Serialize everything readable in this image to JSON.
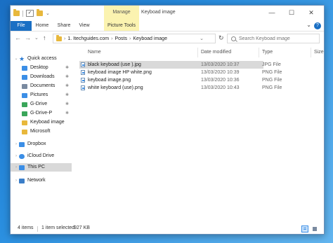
{
  "window": {
    "title": "Keyboad image",
    "manage_label": "Manage",
    "minimize": "—",
    "maximize": "☐",
    "close": "✕"
  },
  "ribbon": {
    "tabs": [
      {
        "label": "File"
      },
      {
        "label": "Home"
      },
      {
        "label": "Share"
      },
      {
        "label": "View"
      },
      {
        "label": "Picture Tools"
      }
    ],
    "collapse": "⌄",
    "help": "?"
  },
  "nav": {
    "back": "←",
    "forward": "→",
    "recent": "⌄",
    "up": "↑",
    "breadcrumb": [
      "1. Itechguides.com",
      "Posts",
      "Keyboad image"
    ],
    "breadcrumb_sep": "›",
    "dropdown": "⌄",
    "refresh": "↻"
  },
  "search": {
    "placeholder": "Search Keyboad image"
  },
  "sidebar": {
    "items": [
      {
        "label": "Quick access",
        "icon": "star-icon"
      },
      {
        "label": "Desktop",
        "icon": "desktop-icon",
        "pinned": true
      },
      {
        "label": "Downloads",
        "icon": "download-icon",
        "pinned": true
      },
      {
        "label": "Documents",
        "icon": "documents-icon",
        "pinned": true
      },
      {
        "label": "Pictures",
        "icon": "pictures-icon",
        "pinned": true
      },
      {
        "label": "G-Drive",
        "icon": "drive-icon",
        "pinned": true
      },
      {
        "label": "G-Drive-P",
        "icon": "drive-icon",
        "pinned": true
      },
      {
        "label": "Keyboad image",
        "icon": "folder-icon"
      },
      {
        "label": "Microsoft",
        "icon": "folder-icon"
      },
      {
        "label": "Dropbox",
        "icon": "dropbox-icon"
      },
      {
        "label": "iCloud Drive",
        "icon": "cloud-icon"
      },
      {
        "label": "This PC",
        "icon": "computer-icon",
        "selected": true
      },
      {
        "label": "Network",
        "icon": "network-icon"
      }
    ],
    "pin_glyph": "📌",
    "chevron": "›"
  },
  "columns": [
    "Name",
    "Date modified",
    "Type",
    "Size"
  ],
  "files": [
    {
      "name": "black keyboad (use ).jpg",
      "date": "13/03/2020 10:37",
      "type": "JPG File",
      "selected": true
    },
    {
      "name": "keyboad image HP white.png",
      "date": "13/03/2020 10:39",
      "type": "PNG File"
    },
    {
      "name": "keyboad image.png",
      "date": "13/03/2020 10:36",
      "type": "PNG File"
    },
    {
      "name": "white keyboard (use).png",
      "date": "13/03/2020 10:43",
      "type": "PNG File"
    }
  ],
  "status": {
    "item_count": "4 items",
    "selection": "1 item selected",
    "size": "927 KB"
  },
  "colors": {
    "accent": "#1a6fc4",
    "manage_highlight": "#fbf3b0",
    "selection": "#d9d9d9"
  }
}
